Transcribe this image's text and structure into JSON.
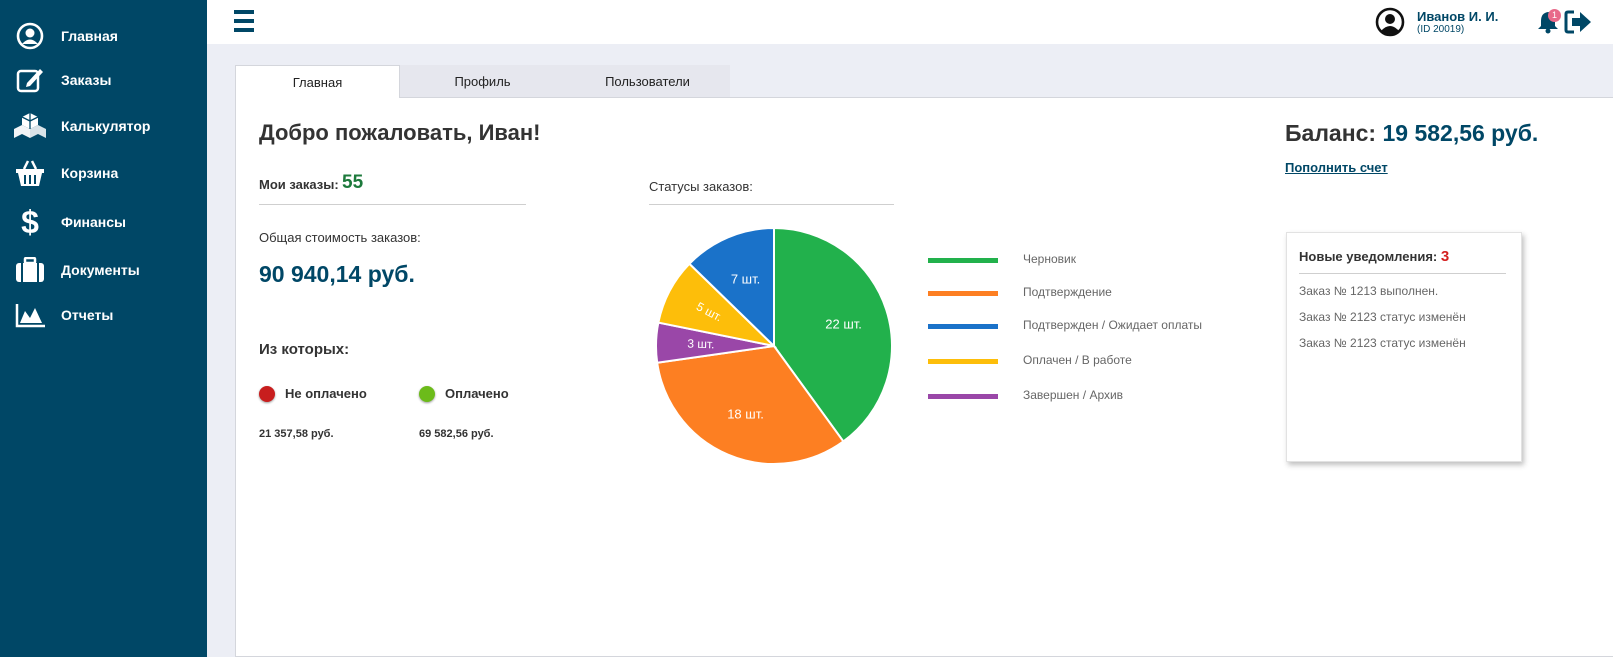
{
  "sidebar": {
    "items": [
      {
        "label": "Главная",
        "icon": "user-circle-icon"
      },
      {
        "label": "Заказы",
        "icon": "edit-icon"
      },
      {
        "label": "Калькулятор",
        "icon": "cubes-icon"
      },
      {
        "label": "Корзина",
        "icon": "basket-icon"
      },
      {
        "label": "Финансы",
        "icon": "dollar-icon"
      },
      {
        "label": "Документы",
        "icon": "briefcase-icon"
      },
      {
        "label": "Отчеты",
        "icon": "area-chart-icon"
      }
    ]
  },
  "header": {
    "user_name": "Иванов И. И.",
    "user_id": "(ID 20019)",
    "bell_badge": "1"
  },
  "tabs": [
    {
      "label": "Главная",
      "active": true
    },
    {
      "label": "Профиль",
      "active": false
    },
    {
      "label": "Пользователи",
      "active": false
    }
  ],
  "main": {
    "welcome": "Добро пожаловать, Иван!",
    "orders_label": "Мои заказы:",
    "orders_count": "55",
    "total_label": "Общая стоимость заказов:",
    "total_value": "90 940,14 руб.",
    "of_which_label": "Из которых:",
    "unpaid_label": "Не оплачено",
    "unpaid_sum": "21 357,58 руб.",
    "paid_label": "Оплачено",
    "paid_sum": "69 582,56 руб."
  },
  "chart_title": "Статусы заказов:",
  "chart_data": {
    "type": "pie",
    "slices": [
      {
        "label": "Черновик",
        "value": 22,
        "value_label": "22 шт.",
        "color": "#22b14c"
      },
      {
        "label": "Подтверждение",
        "value": 18,
        "value_label": "18 шт.",
        "color": "#fd7f22"
      },
      {
        "label": "Подтвержден / Ожидает оплаты",
        "value": 7,
        "value_label": "7 шт.",
        "color": "#1a72c9"
      },
      {
        "label": "Оплачен / В работе",
        "value": 5,
        "value_label": "5 шт.",
        "color": "#fdbe0a"
      },
      {
        "label": "Завершен / Архив",
        "value": 3,
        "value_label": "3 шт.",
        "color": "#9a47a8"
      }
    ],
    "drawing_order": [
      0,
      1,
      4,
      3,
      2
    ],
    "legend_position": "right"
  },
  "balance": {
    "label": "Баланс:",
    "value": "19 582,56 руб.",
    "topup_link": "Пополнить счет"
  },
  "notifications": {
    "title": "Новые уведомления:",
    "count": "3",
    "items": [
      "Заказ № 1213 выполнен.",
      "Заказ № 2123 статус изменён",
      "Заказ № 2123 статус изменён"
    ]
  },
  "colors": {
    "sidebar_bg": "#004766",
    "accent": "#004766",
    "green": "#1d7a3c",
    "unpaid_dot": "#c81e1e",
    "paid_dot": "#6cbb1a"
  }
}
